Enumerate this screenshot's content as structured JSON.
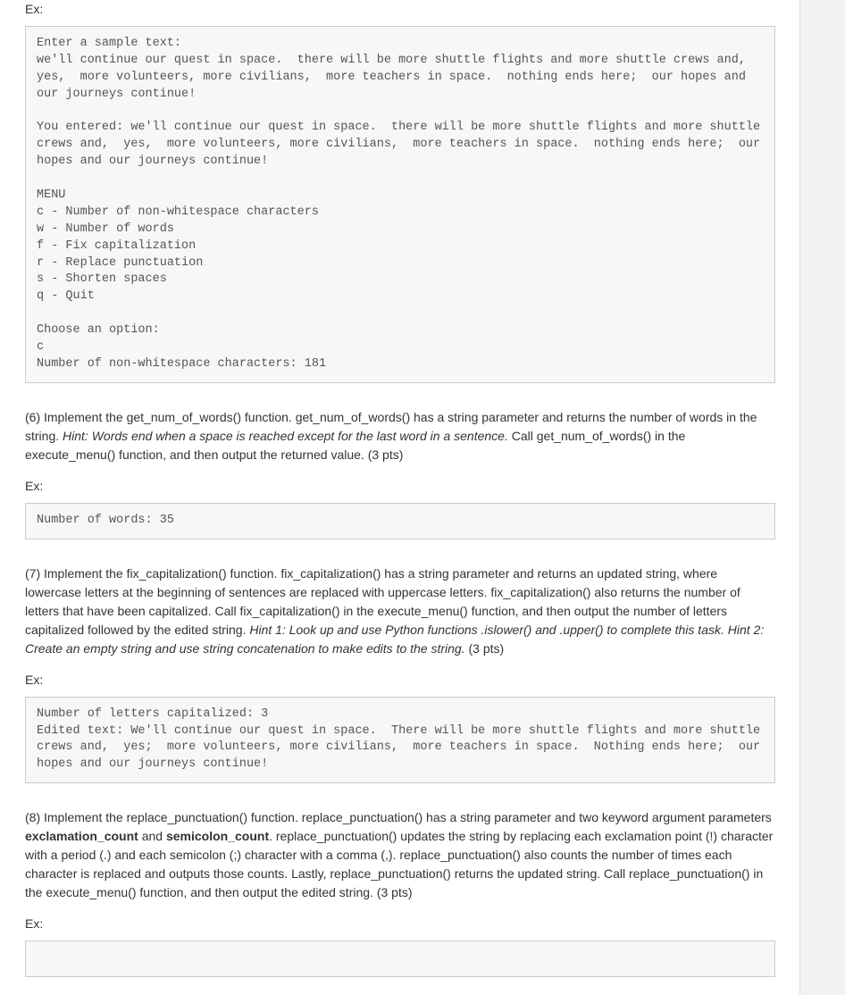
{
  "ex_label": "Ex:",
  "block5_code": "Enter a sample text:\nwe'll continue our quest in space.  there will be more shuttle flights and more shuttle crews and,  yes,  more volunteers, more civilians,  more teachers in space.  nothing ends here;  our hopes and our journeys continue!\n\nYou entered: we'll continue our quest in space.  there will be more shuttle flights and more shuttle crews and,  yes,  more volunteers, more civilians,  more teachers in space.  nothing ends here;  our hopes and our journeys continue!\n\nMENU\nc - Number of non-whitespace characters\nw - Number of words\nf - Fix capitalization\nr - Replace punctuation\ns - Shorten spaces\nq - Quit\n\nChoose an option:\nc\nNumber of non-whitespace characters: 181",
  "step6": {
    "lead": "(6) Implement the get_num_of_words() function. get_num_of_words() has a string parameter and returns the number of words in the string. ",
    "hint": "Hint: Words end when a space is reached except for the last word in a sentence.",
    "trail": " Call get_num_of_words() in the execute_menu() function, and then output the returned value. (3 pts)",
    "code": "Number of words: 35"
  },
  "step7": {
    "lead": "(7) Implement the fix_capitalization() function. fix_capitalization() has a string parameter and returns an updated string, where lowercase letters at the beginning of sentences are replaced with uppercase letters. fix_capitalization() also returns the number of letters that have been capitalized. Call fix_capitalization() in the execute_menu() function, and then output the number of letters capitalized followed by the edited string. ",
    "hint": "Hint 1: Look up and use Python functions .islower() and .upper() to complete this task. Hint 2: Create an empty string and use string concatenation to make edits to the string.",
    "trail": " (3 pts)",
    "code": "Number of letters capitalized: 3\nEdited text: We'll continue our quest in space.  There will be more shuttle flights and more shuttle crews and,  yes;  more volunteers, more civilians,  more teachers in space.  Nothing ends here;  our hopes and our journeys continue!"
  },
  "step8": {
    "lead1": "(8) Implement the replace_punctuation() function. replace_punctuation() has a string parameter and two keyword argument parameters ",
    "kw1": "exclamation_count",
    "and": " and ",
    "kw2": "semicolon_count",
    "lead2": ". replace_punctuation() updates the string by replacing each exclamation point (!) character with a period (.) and each semicolon (;) character with a comma (,). replace_punctuation() also counts the number of times each character is replaced and outputs those counts. Lastly, replace_punctuation() returns the updated string. Call replace_punctuation() in the execute_menu() function, and then output the edited string. (3 pts)",
    "code": " "
  }
}
